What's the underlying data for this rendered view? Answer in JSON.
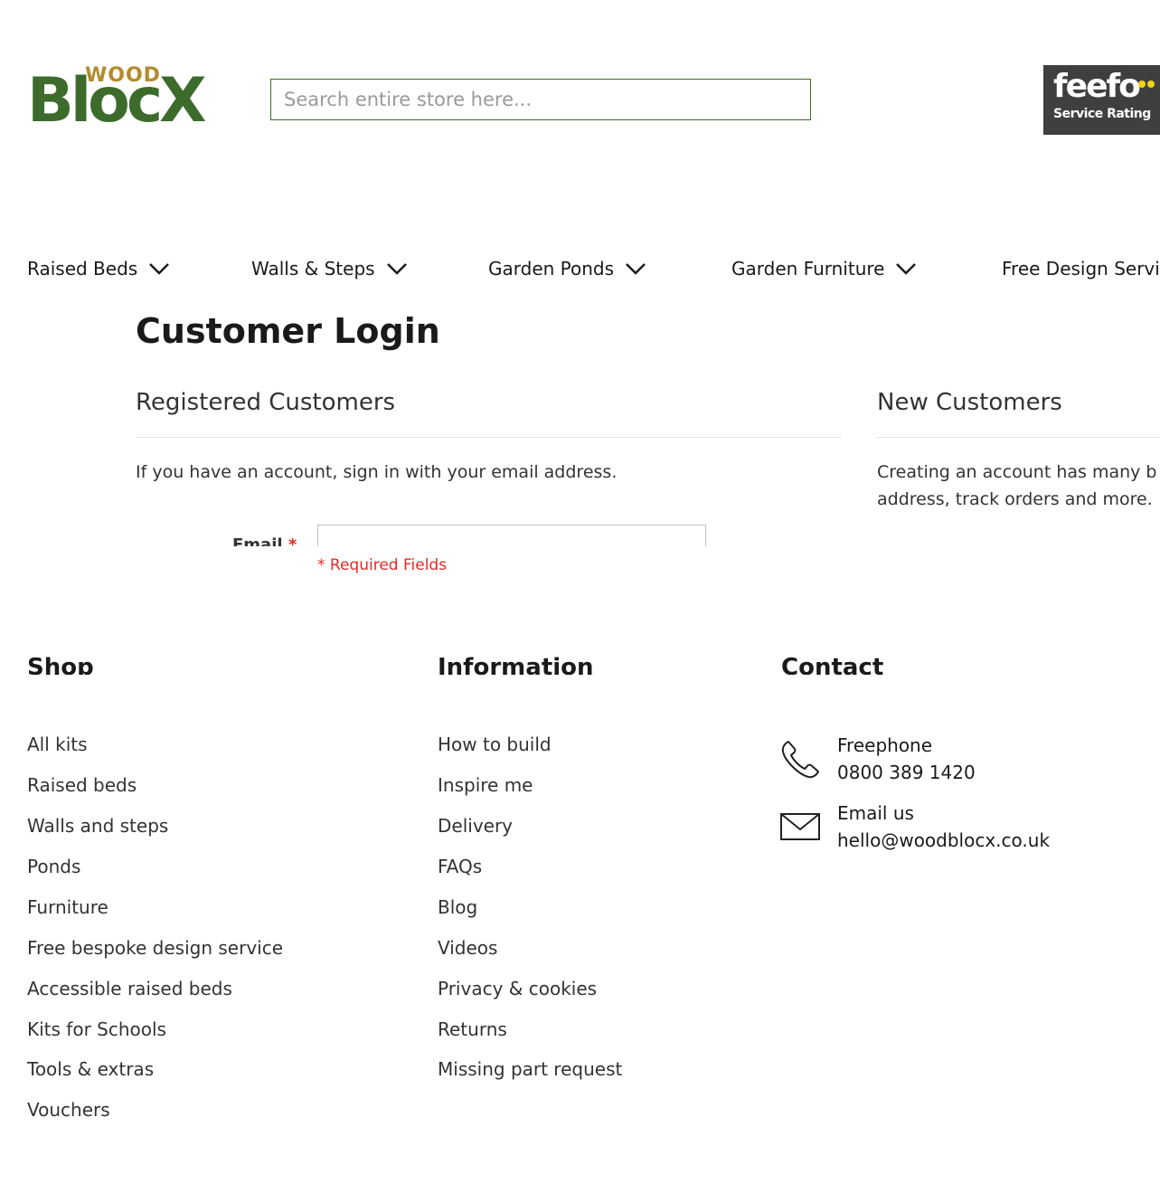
{
  "header": {
    "logo": {
      "small": "WOOD",
      "main": "BlocX"
    },
    "search": {
      "placeholder": "Search entire store here..."
    },
    "feefo": {
      "brand": "feefo",
      "subtitle": "Service Rating"
    }
  },
  "nav": {
    "items": [
      {
        "label": "Raised Beds"
      },
      {
        "label": "Walls & Steps"
      },
      {
        "label": "Garden Ponds"
      },
      {
        "label": "Garden Furniture"
      },
      {
        "label": "Free Design Servic"
      }
    ]
  },
  "login": {
    "title": "Customer Login",
    "registered": {
      "title": "Registered Customers",
      "text": "If you have an account, sign in with your email address.",
      "email_label": "Email",
      "required_star": "*",
      "email_value": "",
      "required_note": "* Required Fields"
    },
    "new_customers": {
      "title": "New Customers",
      "text_line1": "Creating an account has many b",
      "text_line2": "address, track orders and more."
    }
  },
  "footer": {
    "shop": {
      "title": "Shop",
      "links": [
        "All kits",
        "Raised beds",
        "Walls and steps",
        "Ponds",
        "Furniture",
        "Free bespoke design service",
        "Accessible raised beds",
        "Kits for Schools",
        "Tools & extras",
        "Vouchers"
      ]
    },
    "information": {
      "title": "Information",
      "links": [
        "How to build",
        "Inspire me",
        "Delivery",
        "FAQs",
        "Blog",
        "Videos",
        "Privacy & cookies",
        "Returns",
        "Missing part request"
      ]
    },
    "contact": {
      "title": "Contact",
      "phone_label": "Freephone",
      "phone_number": "0800 389 1420",
      "email_label": "Email us",
      "email_address": "hello@woodblocx.co.uk"
    }
  },
  "colors": {
    "brand_green": "#3d6b2c",
    "brand_gold": "#b38b2c",
    "required_red": "#e02b27",
    "feefo_bg": "#3f3f3f",
    "feefo_yellow": "#f5d31a"
  }
}
